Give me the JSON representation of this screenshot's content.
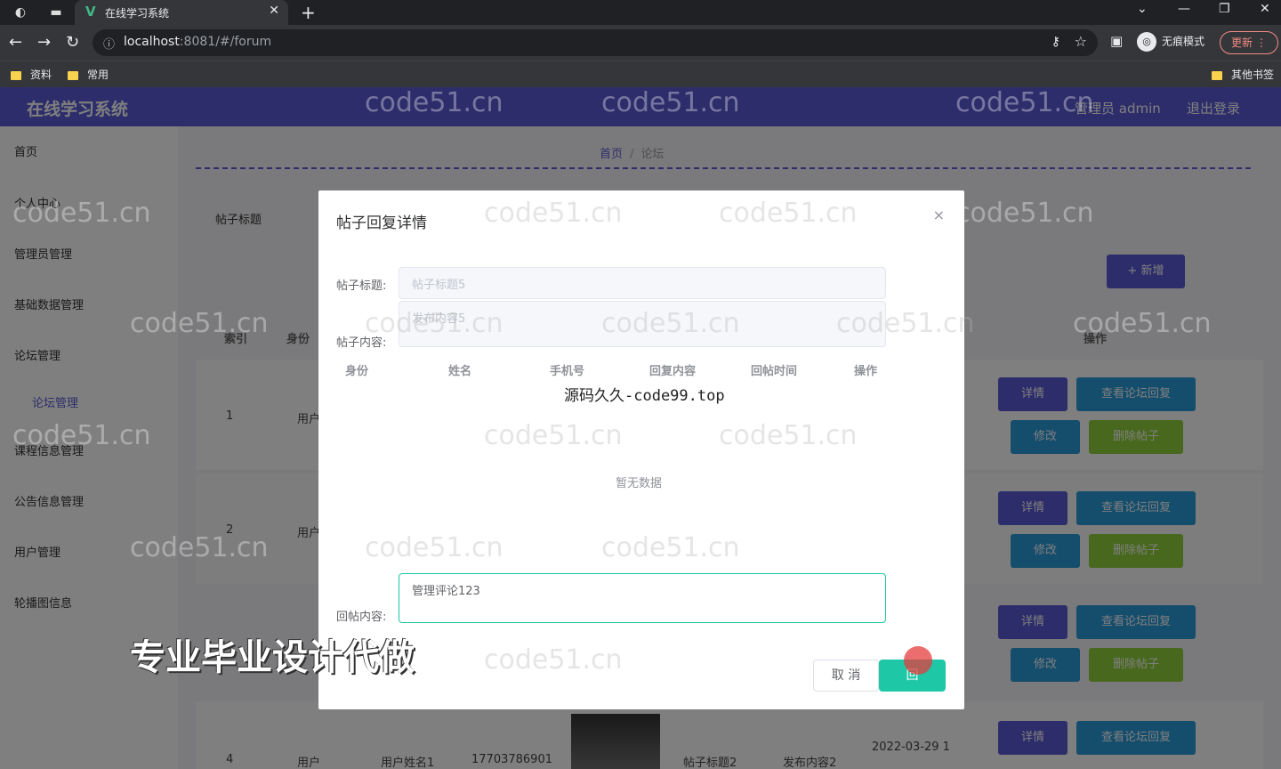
{
  "browser": {
    "tab_title": "在线学习系统",
    "url_host": "localhost",
    "url_rest": ":8081/#/forum",
    "incognito_label": "无痕模式",
    "update_label": "更新",
    "bookmarks": [
      "资料",
      "常用"
    ],
    "other_bookmarks": "其他书签"
  },
  "header": {
    "app_title": "在线学习系统",
    "admin_label": "管理员 admin",
    "logout_label": "退出登录"
  },
  "sidebar": {
    "items": [
      "首页",
      "个人中心",
      "管理员管理",
      "基础数据管理",
      "论坛管理",
      "论坛管理",
      "课程信息管理",
      "公告信息管理",
      "用户管理",
      "轮播图信息"
    ]
  },
  "breadcrumb": {
    "home": "首页",
    "current": "论坛"
  },
  "toolbar": {
    "search_label": "帖子标题",
    "add_label": "+ 新增"
  },
  "table": {
    "headers": {
      "index": "索引",
      "identity": "身份",
      "ops": "操作"
    },
    "rows": [
      {
        "index": "1",
        "identity": "用户"
      },
      {
        "index": "2",
        "identity": "用户"
      },
      {
        "index": "4",
        "identity": "用户",
        "name": "用户姓名1",
        "phone": "17703786901",
        "title": "帖子标题2",
        "content": "发布内容2",
        "time": "2022-03-29 1"
      }
    ],
    "buttons": {
      "detail": "详情",
      "view": "查看论坛回复",
      "edit": "修改",
      "delete": "删除帖子"
    }
  },
  "modal": {
    "title": "帖子回复详情",
    "close": "×",
    "post_title_label": "帖子标题:",
    "post_title_value": "帖子标题5",
    "post_content_label": "帖子内容:",
    "post_content_value": "发布内容5",
    "columns": [
      "身份",
      "姓名",
      "手机号",
      "回复内容",
      "回帖时间",
      "操作"
    ],
    "source_text": "源码久久-code99.top",
    "empty_text": "暂无数据",
    "reply_label": "回帖内容:",
    "reply_value": "管理评论123",
    "cancel_label": "取 消",
    "reply_button_label": "回"
  },
  "watermark_text": "code51.cn",
  "promo_text": "专业毕业设计代做"
}
